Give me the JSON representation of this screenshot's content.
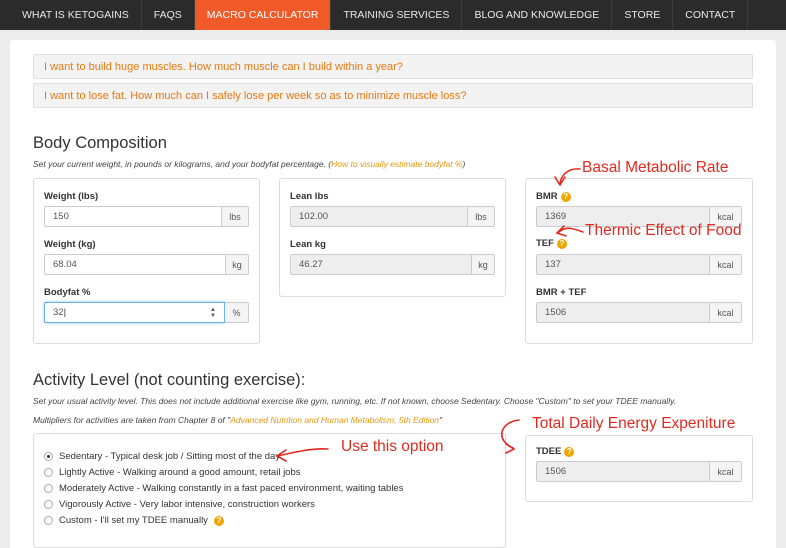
{
  "nav": {
    "items": [
      "WHAT IS KETOGAINS",
      "FAQS",
      "MACRO CALCULATOR",
      "TRAINING SERVICES",
      "BLOG AND KNOWLEDGE",
      "STORE",
      "CONTACT"
    ],
    "active": "MACRO CALCULATOR"
  },
  "faq": [
    "I want to build huge muscles. How much muscle can I build within a year?",
    "I want to lose fat. How much can I safely lose per week so as to minimize muscle loss?"
  ],
  "body_comp": {
    "title": "Body Composition",
    "desc": "Set your current weight, in pounds or kilograms, and your bodyfat percentage. (",
    "desc_link": "How to visually estimate bodyfat %",
    "desc_end": ")",
    "weight_lbs": {
      "label": "Weight (lbs)",
      "value": "150",
      "unit": "lbs"
    },
    "weight_kg": {
      "label": "Weight (kg)",
      "value": "68.04",
      "unit": "kg"
    },
    "bodyfat": {
      "label": "Bodyfat %",
      "value": "32",
      "unit": "%"
    },
    "lean_lbs": {
      "label": "Lean lbs",
      "value": "102.00",
      "unit": "lbs"
    },
    "lean_kg": {
      "label": "Lean kg",
      "value": "46.27",
      "unit": "kg"
    }
  },
  "energy": {
    "bmr": {
      "label": "BMR",
      "value": "1369",
      "unit": "kcal"
    },
    "tef": {
      "label": "TEF",
      "value": "137",
      "unit": "kcal"
    },
    "bmr_tef": {
      "label": "BMR + TEF",
      "value": "1506",
      "unit": "kcal"
    },
    "tdee": {
      "label": "TDEE",
      "value": "1506",
      "unit": "kcal"
    }
  },
  "activity": {
    "title": "Activity Level (not counting exercise):",
    "desc1": "Set your usual activity level. This does not include additional exercise like gym, running, etc. If not known, choose Sedentary. Choose \"Custom\" to set your TDEE manually.",
    "desc2": "Multipliers for activities are taken from Chapter 8 of \"",
    "desc2_link": "Advanced Nutrition and Human Metabolism, 5th Edition",
    "desc2_end": "\"",
    "options": [
      "Sedentary - Typical desk job / Sitting most of the day",
      "Lightly Active - Walking around a good amount, retail jobs",
      "Moderately Active - Walking constantly in a fast paced environment, waiting tables",
      "Vigorously Active - Very labor intensive, construction workers",
      "Custom - I'll set my TDEE manually"
    ],
    "selected": 0
  },
  "annotations": {
    "bmr": "Basal Metabolic Rate",
    "tef": "Thermic Effect of Food",
    "tdee": "Total Daily Energy Expeniture",
    "option": "Use this option"
  },
  "colors": {
    "accent": "#f05a28",
    "link": "#e8980e",
    "faq_text": "#e8780e",
    "annotation": "#e02a20",
    "help_icon": "#f0a500"
  }
}
